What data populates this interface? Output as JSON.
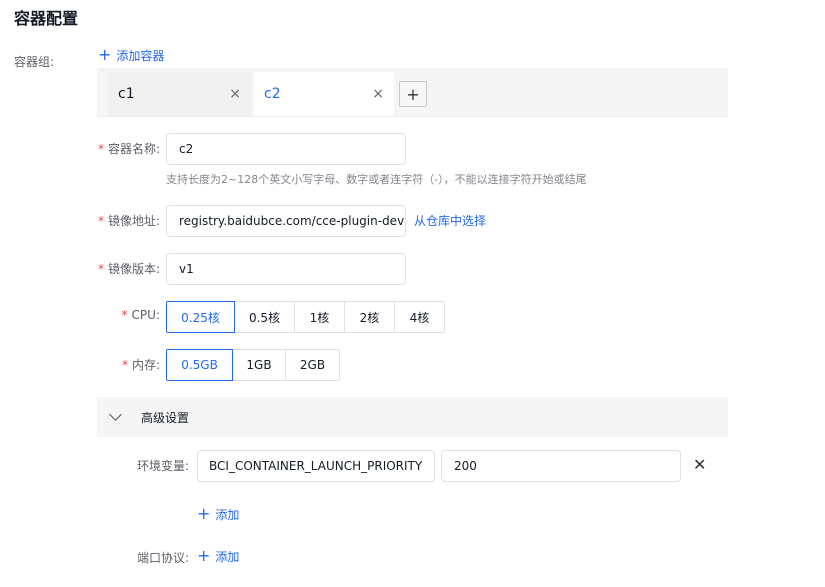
{
  "section_title": "容器配置",
  "container_group": {
    "label": "容器组:",
    "add_label": "添加容器",
    "tabs": [
      {
        "label": "c1",
        "close": "×"
      },
      {
        "label": "c2",
        "close": "×"
      }
    ],
    "add_tab": "+"
  },
  "form": {
    "name": {
      "label": "容器名称:",
      "value": "c2",
      "hint": "支持长度为2~128个英文小写字母、数字或者连字符（-），不能以连接字符开始或结尾"
    },
    "image": {
      "label": "镜像地址:",
      "value": "registry.baidubce.com/cce-plugin-dev",
      "select_link": "从仓库中选择"
    },
    "version": {
      "label": "镜像版本:",
      "value": "v1"
    },
    "cpu": {
      "label": "CPU:",
      "options": [
        "0.25核",
        "0.5核",
        "1核",
        "2核",
        "4核"
      ],
      "selected": "0.25核"
    },
    "memory": {
      "label": "内存:",
      "options": [
        "0.5GB",
        "1GB",
        "2GB"
      ],
      "selected": "0.5GB"
    }
  },
  "advanced": {
    "title": "高级设置",
    "env": {
      "label": "环境变量:",
      "key": "BCI_CONTAINER_LAUNCH_PRIORITY",
      "value": "200",
      "add_label": "添加"
    },
    "port": {
      "label": "端口协议:",
      "add_label": "添加"
    }
  },
  "required_mark": "*",
  "colors": {
    "accent": "#2468f2",
    "required": "#f33e3e"
  }
}
